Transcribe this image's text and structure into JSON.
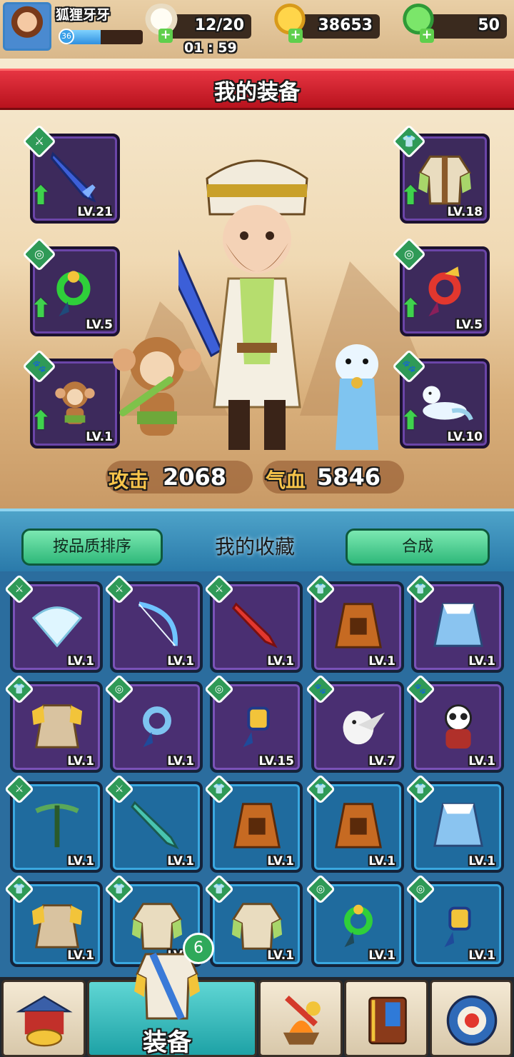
{
  "player": {
    "name": "狐狸牙牙",
    "level": "36",
    "xp_fraction": 0.45
  },
  "resources": {
    "stamina": "12/20",
    "timer": "01 : 59",
    "gold": "38653",
    "gems": "50"
  },
  "equipment": {
    "title": "我的装备",
    "slots": [
      {
        "type_icon": "sword-icon",
        "level": "LV.21"
      },
      {
        "type_icon": "armor-icon",
        "level": "LV.18"
      },
      {
        "type_icon": "amulet-icon",
        "level": "LV.5"
      },
      {
        "type_icon": "amulet-icon",
        "level": "LV.5"
      },
      {
        "type_icon": "paw-icon",
        "level": "LV.1"
      },
      {
        "type_icon": "paw-icon",
        "level": "LV.10"
      }
    ],
    "attack_label": "攻击",
    "attack_value": "2068",
    "hp_label": "气血",
    "hp_value": "5846"
  },
  "collection": {
    "sort_label": "按品质排序",
    "title": "我的收藏",
    "synth_label": "合成",
    "items": [
      {
        "kind": "sword-icon",
        "level": "LV.1",
        "rarity": "purple",
        "art": "fan"
      },
      {
        "kind": "sword-icon",
        "level": "LV.1",
        "rarity": "purple",
        "art": "bow"
      },
      {
        "kind": "sword-icon",
        "level": "LV.1",
        "rarity": "purple",
        "art": "dagger"
      },
      {
        "kind": "armor-icon",
        "level": "LV.1",
        "rarity": "purple",
        "art": "cloak"
      },
      {
        "kind": "armor-icon",
        "level": "LV.1",
        "rarity": "purple",
        "art": "furcoat"
      },
      {
        "kind": "armor-icon",
        "level": "LV.1",
        "rarity": "purple",
        "art": "goldarmor"
      },
      {
        "kind": "amulet-icon",
        "level": "LV.1",
        "rarity": "purple",
        "art": "bluejade"
      },
      {
        "kind": "amulet-icon",
        "level": "LV.15",
        "rarity": "purple",
        "art": "goldjade"
      },
      {
        "kind": "paw-icon",
        "level": "LV.7",
        "rarity": "purple",
        "art": "owl"
      },
      {
        "kind": "paw-icon",
        "level": "LV.1",
        "rarity": "purple",
        "art": "panda"
      },
      {
        "kind": "sword-icon",
        "level": "LV.1",
        "rarity": "blue",
        "art": "crossbow"
      },
      {
        "kind": "sword-icon",
        "level": "LV.1",
        "rarity": "blue",
        "art": "greenblade"
      },
      {
        "kind": "armor-icon",
        "level": "LV.1",
        "rarity": "blue",
        "art": "cloak"
      },
      {
        "kind": "armor-icon",
        "level": "LV.1",
        "rarity": "blue",
        "art": "cloak"
      },
      {
        "kind": "armor-icon",
        "level": "LV.1",
        "rarity": "blue",
        "art": "furcoat"
      },
      {
        "kind": "armor-icon",
        "level": "LV.1",
        "rarity": "blue",
        "art": "goldarmor"
      },
      {
        "kind": "armor-icon",
        "level": "LV.1",
        "rarity": "blue",
        "art": "robe"
      },
      {
        "kind": "armor-icon",
        "level": "LV.1",
        "rarity": "blue",
        "art": "robe"
      },
      {
        "kind": "amulet-icon",
        "level": "LV.1",
        "rarity": "blue",
        "art": "greenjade"
      },
      {
        "kind": "amulet-icon",
        "level": "LV.1",
        "rarity": "blue",
        "art": "goldjade"
      }
    ]
  },
  "nav": {
    "active_label": "装备",
    "badge_count": "6",
    "tabs": [
      "shop-icon",
      "equipment-icon",
      "forge-icon",
      "book-icon",
      "settings-icon"
    ]
  },
  "colors": {
    "banner_red": "#d61f2c",
    "panel_cream": "#f3e1c2",
    "rarity_purple": "#4a2f72",
    "rarity_blue": "#1f6b9e",
    "button_green": "#3fcf8c",
    "accent_gold": "#f7c44a"
  }
}
